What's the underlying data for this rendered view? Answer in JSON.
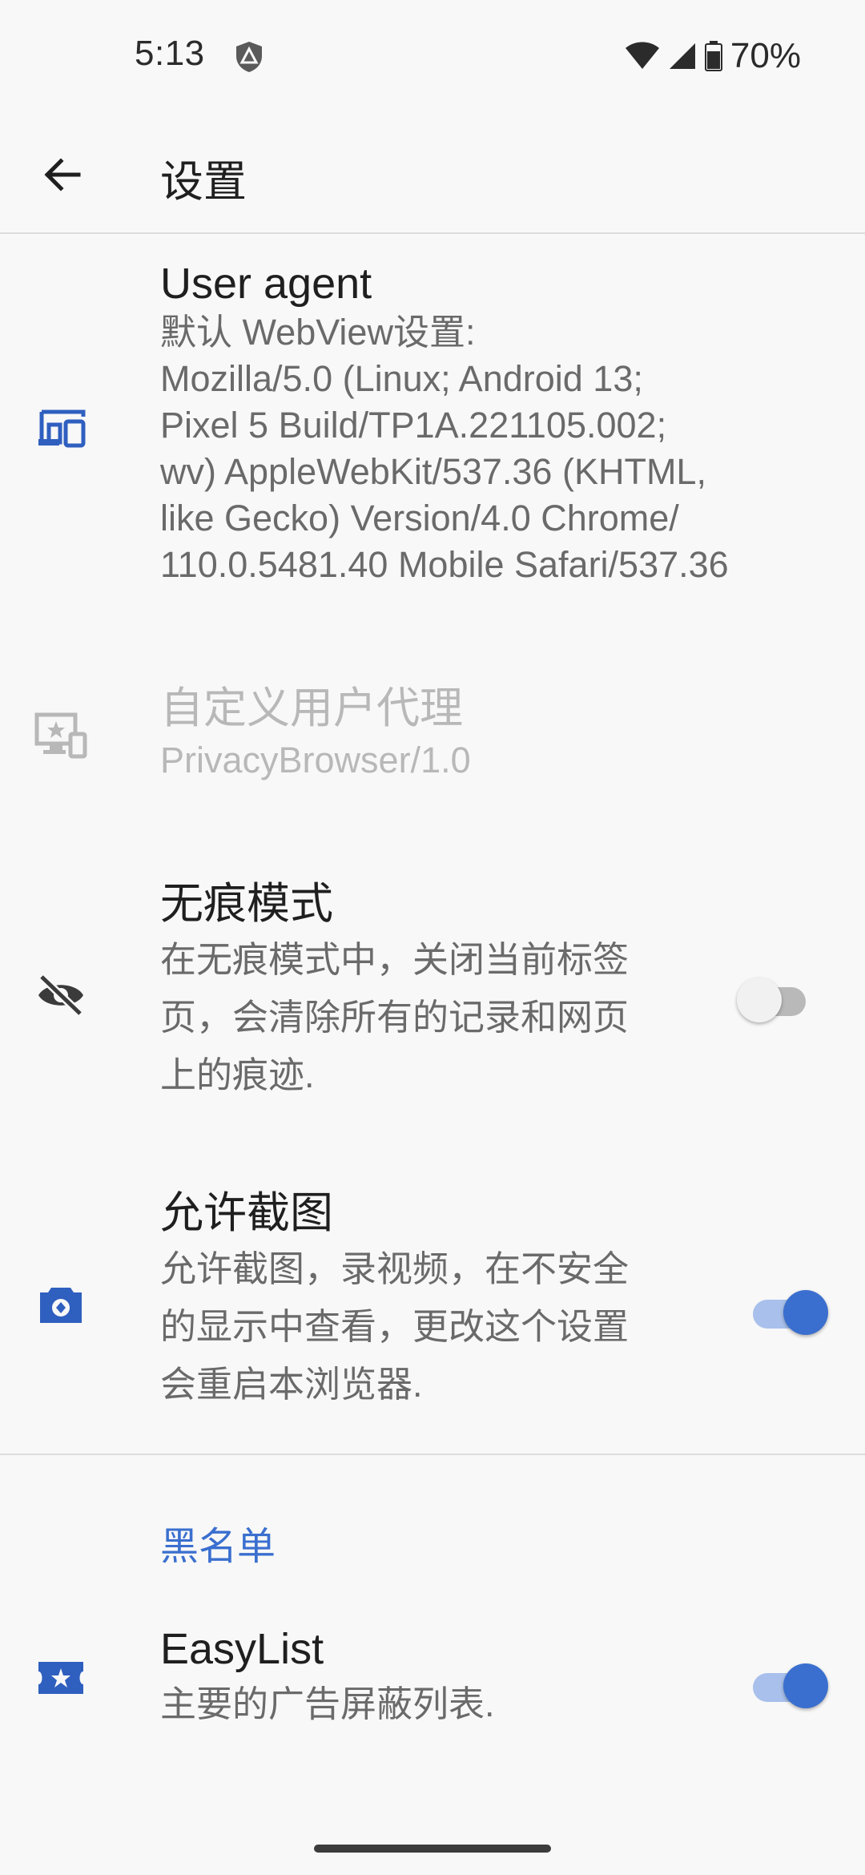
{
  "status_bar": {
    "time": "5:13",
    "battery_text": "70%"
  },
  "toolbar": {
    "title": "设置"
  },
  "prefs": {
    "user_agent": {
      "title": "User agent",
      "summary_lines": [
        "默认 WebView设置:",
        "Mozilla/5.0 (Linux; Android 13;",
        "Pixel 5 Build/TP1A.221105.002;",
        "wv) AppleWebKit/537.36 (KHTML,",
        "like Gecko) Version/4.0 Chrome/",
        "110.0.5481.40 Mobile Safari/537.36"
      ],
      "icon": "devices-icon"
    },
    "custom_user_agent": {
      "title": "自定义用户代理",
      "summary": "PrivacyBrowser/1.0",
      "icon": "custom-display-icon"
    },
    "incognito": {
      "title": "无痕模式",
      "summary_lines": [
        "在无痕模式中，关闭当前标签",
        "页，会清除所有的记录和网页",
        "上的痕迹."
      ],
      "checked": false,
      "icon": "eye-off-icon"
    },
    "screenshots": {
      "title": "允许截图",
      "summary_lines": [
        "允许截图，录视频，在不安全",
        "的显示中查看，更改这个设置",
        "会重启本浏览器."
      ],
      "checked": true,
      "icon": "camera-icon"
    }
  },
  "blocklists": {
    "category": "黑名单",
    "easylist": {
      "title": "EasyList",
      "summary": "主要的广告屏蔽列表.",
      "checked": true,
      "icon": "star-ticket-icon"
    }
  },
  "colors": {
    "accent": "#3a6fcf",
    "icon_blue": "#2f5fbf",
    "disabled": "#b8b8b8"
  }
}
